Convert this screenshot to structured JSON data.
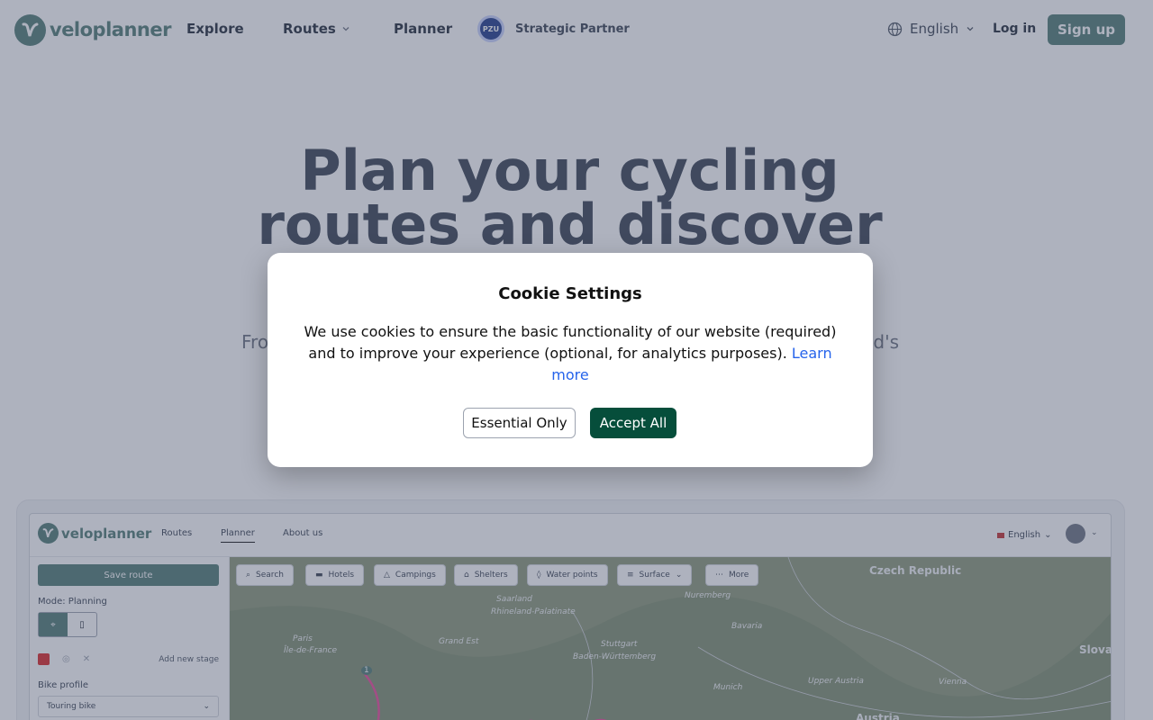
{
  "header": {
    "brand": "veloplanner",
    "nav": {
      "explore": "Explore",
      "routes": "Routes",
      "planner": "Planner"
    },
    "partner": {
      "badge": "PZU",
      "label": "Strategic Partner"
    },
    "language": "English",
    "login": "Log in",
    "signup": "Sign up"
  },
  "hero": {
    "title_line1": "Plan your cycling",
    "title_line2": "routes and discover",
    "sub_left": "Fro",
    "sub_right": "d's"
  },
  "preview": {
    "brand": "veloplanner",
    "nav": {
      "routes": "Routes",
      "planner": "Planner",
      "about": "About us"
    },
    "language": "English",
    "sidebar": {
      "save_route": "Save route",
      "mode_label": "Mode: Planning",
      "add_stage": "Add new stage",
      "bike_profile_label": "Bike profile",
      "bike_profile_value": "Touring bike"
    },
    "map_chips": [
      "Search",
      "Hotels",
      "Campings",
      "Shelters",
      "Water points",
      "Surface",
      "More"
    ],
    "map_labels": {
      "czech": "Czech Republic",
      "slovak": "Slovak",
      "nuremberg": "Nuremberg",
      "bavaria": "Bavaria",
      "paris": "Paris",
      "ile": "Île-de-France",
      "saarland": "Saarland",
      "rheinland": "Rhineland-Palatinate",
      "grand_est": "Grand Est",
      "stuttgart": "Stuttgart",
      "baden": "Baden-Württemberg",
      "munich": "Munich",
      "upper_austria": "Upper Austria",
      "vienna": "Vienna",
      "austria": "Austria"
    },
    "stage_marker": "1"
  },
  "cookie": {
    "title": "Cookie Settings",
    "text": "We use cookies to ensure the basic functionality of our website (required) and to improve your experience (optional, for analytics purposes).",
    "link": "Learn more",
    "essential": "Essential Only",
    "accept": "Accept All"
  },
  "colors": {
    "brand": "#4f7a74",
    "accept": "#064e3b",
    "link": "#2563eb"
  }
}
